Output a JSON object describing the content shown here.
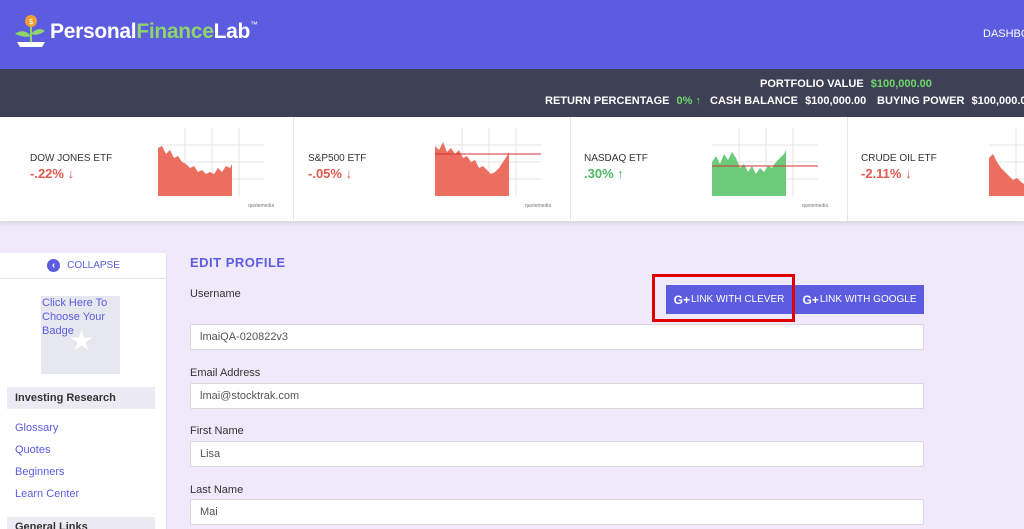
{
  "app": {
    "brand_part1": "Personal",
    "brand_part2": "Finance",
    "brand_part3": "Lab",
    "brand_tm": "™",
    "nav_dashboard": "DASHBO"
  },
  "portfolio": {
    "value_label": "PORTFOLIO VALUE",
    "value": "$100,000.00",
    "return_label": "RETURN PERCENTAGE",
    "return_value": "0%",
    "cash_label": "CASH BALANCE",
    "cash_value": "$100,000.00",
    "buying_label": "BUYING POWER",
    "buying_value": "$100,000.0"
  },
  "tickers": [
    {
      "name": "DOW JONES ETF",
      "change": "-.22%",
      "direction": "down"
    },
    {
      "name": "S&P500 ETF",
      "change": "-.05%",
      "direction": "down"
    },
    {
      "name": "NASDAQ ETF",
      "change": ".30%",
      "direction": "up"
    },
    {
      "name": "CRUDE OIL ETF",
      "change": "-2.11%",
      "direction": "down"
    }
  ],
  "chart_credit": "quotemedia",
  "sidebar": {
    "collapse_label": "COLLAPSE",
    "badge_text": "Click Here To Choose Your Badge",
    "section1": "Investing Research",
    "links": [
      "Glossary",
      "Quotes",
      "Beginners",
      "Learn Center"
    ],
    "section2": "General Links"
  },
  "form": {
    "title": "EDIT PROFILE",
    "username_label": "Username",
    "username_value": "lmaiQA-020822v3",
    "email_label": "Email Address",
    "email_value": "lmai@stocktrak.com",
    "first_label": "First Name",
    "first_value": "Lisa",
    "last_label": "Last Name",
    "last_value": "Mai",
    "clever_button": "LINK WITH CLEVER",
    "google_button": "LINK WITH GOOGLE",
    "button_prefix": "G+"
  },
  "colors": {
    "brand": "#5b5ce0",
    "portfolio_bar": "#3e4156",
    "positive": "#4bb865",
    "negative": "#e05a4c",
    "highlight": "#e00000"
  }
}
